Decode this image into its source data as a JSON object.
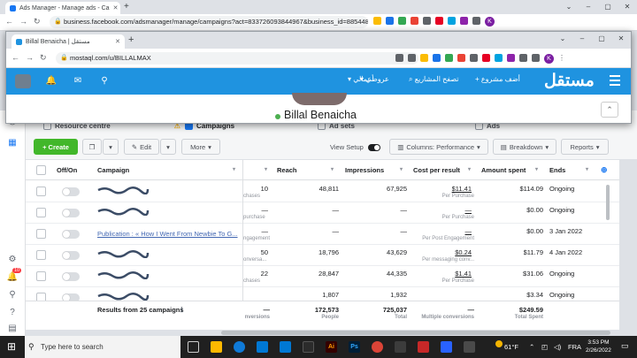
{
  "back_browser": {
    "tab_title": "Ads Manager - Manage ads - Ca",
    "url": "business.facebook.com/adsmanager/manage/campaigns?act=833726093844967&business_id=88544838..."
  },
  "front_browser": {
    "tab_title": "Billal Benaicha | مستقل",
    "url": "mostaql.com/u/BILLALMAX"
  },
  "mostaql": {
    "logo": "مستقل",
    "nav": {
      "add_project": "أضف مشروع",
      "browse_projects": "تصفح المشاريع",
      "offers": "عروضي",
      "my_work": "أعمالي"
    },
    "profile_name": "Billal Benaicha"
  },
  "fb": {
    "tabs": {
      "resource": "Resource centre",
      "campaigns": "Campaigns",
      "adsets": "Ad sets",
      "ads": "Ads"
    },
    "toolbar": {
      "create": "+ Create",
      "edit": "Edit",
      "more": "More",
      "view_setup": "View Setup",
      "columns": "Columns: Performance",
      "breakdown": "Breakdown",
      "reports": "Reports"
    },
    "columns": [
      "Off/On",
      "Campaign",
      "Reach",
      "Impressions",
      "Cost per result",
      "Amount spent",
      "Ends"
    ],
    "rows": [
      {
        "campaign": "",
        "result": "10",
        "result_sub": "chases",
        "reach": "48,811",
        "impressions": "67,925",
        "cpr": "$11.41",
        "cpr_sub": "Per Purchase",
        "spent": "$114.09",
        "ends": "Ongoing"
      },
      {
        "campaign": "",
        "result": "—",
        "result_sub": "purchase",
        "reach": "—",
        "impressions": "—",
        "cpr": "—",
        "cpr_sub": "Per Purchase",
        "spent": "$0.00",
        "ends": "Ongoing"
      },
      {
        "campaign": "Publication : « How I Went From Newbie To G...",
        "result": "—",
        "result_sub": "ngagement",
        "reach": "—",
        "impressions": "—",
        "cpr": "—",
        "cpr_sub": "Per Post Engagement",
        "spent": "$0.00",
        "ends": "3 Jan 2022"
      },
      {
        "campaign": "",
        "result": "50",
        "result_sub": "onversa...",
        "reach": "18,796",
        "impressions": "43,629",
        "cpr": "$0.24",
        "cpr_sub": "Per messaging conv...",
        "spent": "$11.79",
        "ends": "4 Jan 2022"
      },
      {
        "campaign": "",
        "result": "22",
        "result_sub": "chases",
        "reach": "28,847",
        "impressions": "44,335",
        "cpr": "$1.41",
        "cpr_sub": "Per Purchase",
        "spent": "$31.06",
        "ends": "Ongoing"
      },
      {
        "campaign": "",
        "result": "",
        "result_sub": "",
        "reach": "1,807",
        "impressions": "1,932",
        "cpr": "",
        "cpr_sub": "",
        "spent": "$3.34",
        "ends": "Ongoing"
      }
    ],
    "totals": {
      "label": "Results from 25 campaigns",
      "result": "—",
      "result_sub": "nversions",
      "reach": "172,573",
      "reach_sub": "People",
      "impressions": "725,037",
      "impressions_sub": "Total",
      "cpr": "—",
      "cpr_sub": "Multiple conversions",
      "spent": "$249.59",
      "spent_sub": "Total Spent"
    },
    "notif_count": "10"
  },
  "taskbar": {
    "search_placeholder": "Type here to search",
    "weather": "61°F",
    "lang": "FRA",
    "time": "3:53 PM",
    "date": "2/26/2022"
  },
  "colors": {
    "fb_green": "#42b72a",
    "mostaql_blue": "#1f93e0",
    "link_blue": "#4267b2"
  }
}
